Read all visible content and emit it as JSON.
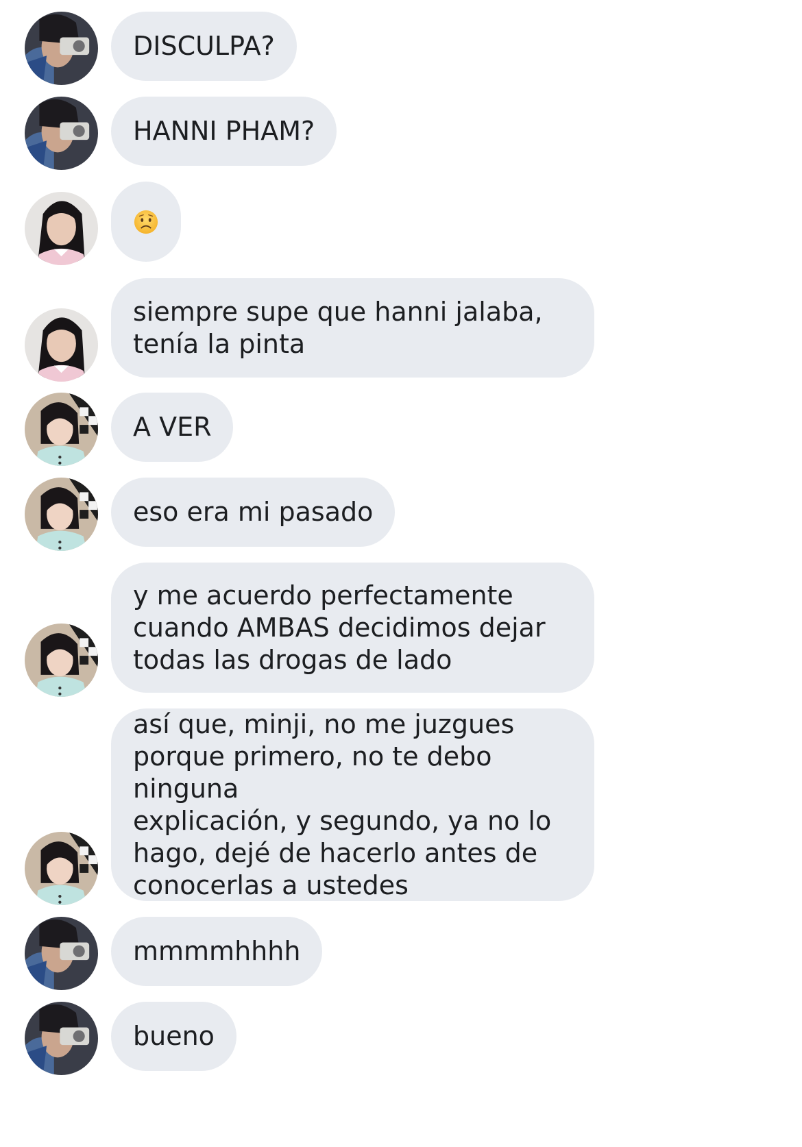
{
  "messages": [
    {
      "sender": "hanni",
      "text": "DISCULPA?"
    },
    {
      "sender": "hanni",
      "text": "HANNI PHAM?"
    },
    {
      "sender": "minji",
      "text": "",
      "emoji": "worried-face"
    },
    {
      "sender": "minji",
      "text": "siempre supe que hanni jalaba,\ntenía la pinta"
    },
    {
      "sender": "third",
      "text": "A VER"
    },
    {
      "sender": "third",
      "text": "eso era mi pasado"
    },
    {
      "sender": "third",
      "text": "y me acuerdo perfectamente\ncuando AMBAS decidimos dejar\ntodas las drogas de lado"
    },
    {
      "sender": "third",
      "text": "así que, minji, no me juzgues\nporque primero, no te debo ninguna\nexplicación, y segundo, ya no lo\nhago, dejé de hacerlo antes de\nconocerlas a ustedes"
    },
    {
      "sender": "hanni",
      "text": "mmmmhhhh"
    },
    {
      "sender": "hanni",
      "text": "bueno"
    }
  ],
  "colors": {
    "bubble": "#e8ebf0",
    "text": "#1c1e21",
    "background": "#ffffff"
  }
}
